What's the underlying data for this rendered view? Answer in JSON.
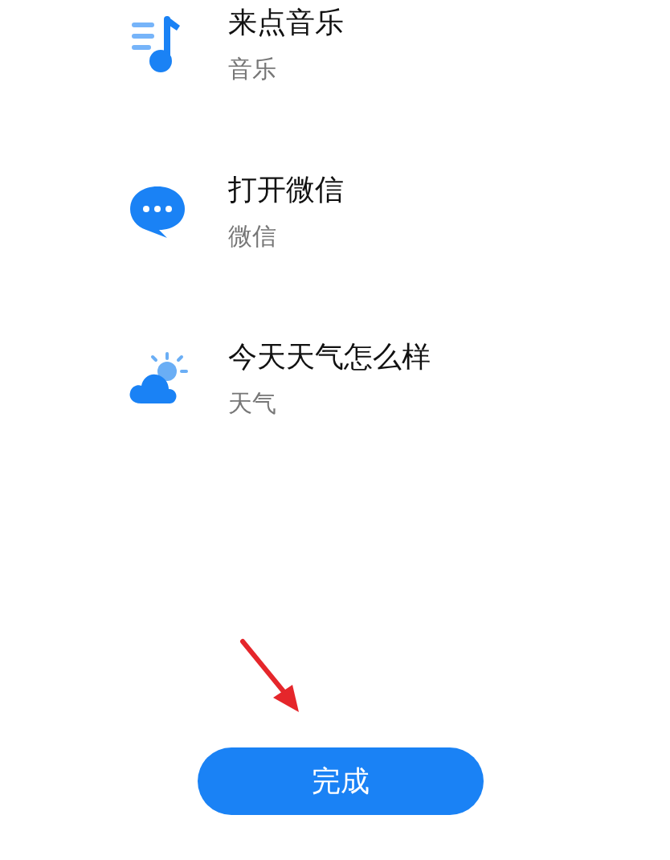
{
  "items": [
    {
      "kind": "music",
      "title": "来点音乐",
      "subtitle": "音乐"
    },
    {
      "kind": "chat",
      "title": "打开微信",
      "subtitle": "微信"
    },
    {
      "kind": "weather",
      "title": "今天天气怎么样",
      "subtitle": "天气"
    }
  ],
  "button": {
    "label": "完成"
  }
}
